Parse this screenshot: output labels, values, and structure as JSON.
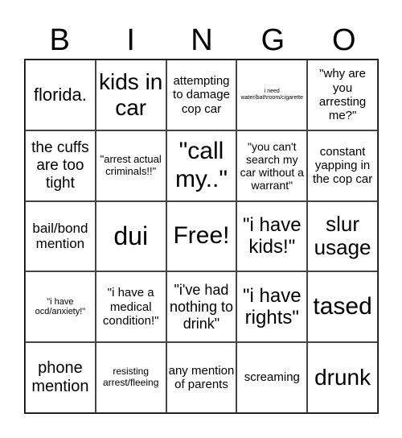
{
  "header": [
    "B",
    "I",
    "N",
    "G",
    "O"
  ],
  "cells": [
    "florida.",
    "kids in car",
    "attempting to damage cop car",
    "i need water/bathroom/cigarette",
    "\"why are you arresting me?\"",
    "the cuffs are too tight",
    "\"arrest actual criminals!!\"",
    "\"call my..\"",
    "\"you can't search my car without a warrant\"",
    "constant yapping in the cop car",
    "bail/bond mention",
    "dui",
    "Free!",
    "\"i have kids!\"",
    "slur usage",
    "\"i have ocd/anxiety!\"",
    "\"i have a medical condition!\"",
    "\"i've had nothing to drink\"",
    "\"i have rights\"",
    "tased",
    "phone mention",
    "resisting arrest/fleeing",
    "any mention of parents",
    "screaming",
    "drunk"
  ]
}
